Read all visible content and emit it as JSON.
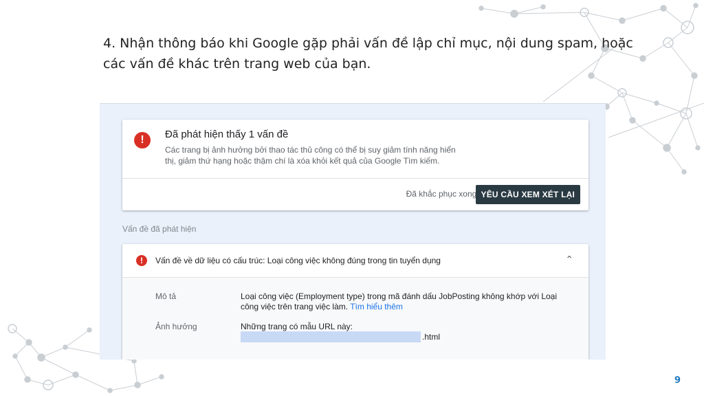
{
  "slide": {
    "title": "4. Nhận thông báo khi Google gặp phải vấn đề lập chỉ mục, nội dung spam, hoặc các vấn đề khác trên trang web của bạn.",
    "page_number": "9",
    "decoration_color": "#c9ced3"
  },
  "issue_summary": {
    "icon": "error-icon",
    "icon_glyph": "!",
    "title": "Đã phát hiện thấy 1 vấn đề",
    "description": "Các trang bị ảnh hưởng bởi thao tác thủ công có thể bị suy giảm tính năng hiển thị, giảm thứ hạng hoặc thậm chí là xóa khỏi kết quả của Google Tìm kiếm.",
    "fixed_question": "Đã khắc phục xong?",
    "review_button_label": "YÊU CẦU XEM XÉT LẠI"
  },
  "detected_issues": {
    "section_label": "Vấn đề đã phát hiện",
    "issue": {
      "icon": "error-icon",
      "icon_glyph": "!",
      "header": "Vấn đề về dữ liệu có cấu trúc: Loại công việc không đúng trong tin tuyển dụng",
      "chevron": "⌃",
      "description_label": "Mô tả",
      "description_text": "Loại công việc (Employment type) trong mã đánh dấu JobPosting không khớp với Loại công việc trên trang việc làm.",
      "learn_more_link": "Tìm hiểu thêm",
      "impact_label": "Ảnh hưởng",
      "impact_text": "Những trang có mẫu URL này:",
      "url_suffix": ".html"
    }
  },
  "colors": {
    "error": "#d93025",
    "button": "#2a3a42",
    "link": "#1a73e8",
    "page_number": "#1f7bc0",
    "panel_background": "#eaf1fb"
  }
}
